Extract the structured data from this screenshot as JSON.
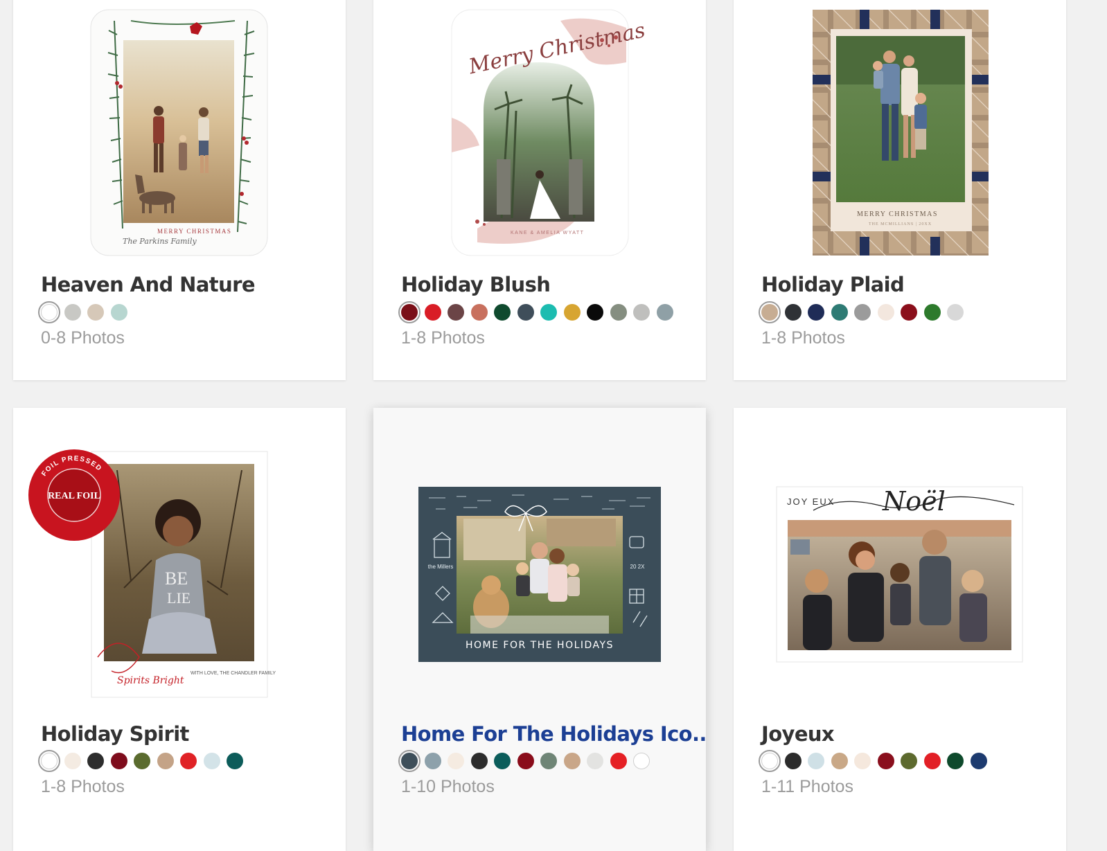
{
  "cards": [
    {
      "title": "Heaven And Nature",
      "photos": "0-8 Photos",
      "greeting": "MERRY CHRISTMAS",
      "signature": "The Parkins Family",
      "swatches": [
        "#ffffff",
        "#c8c8c4",
        "#d6c8b8",
        "#b7d6d0"
      ]
    },
    {
      "title": "Holiday Blush",
      "photos": "1-8 Photos",
      "greeting": "Merry Christmas",
      "signature": "KANE & AMELIA WYATT",
      "swatches": [
        "#7a0f18",
        "#d91d26",
        "#6b4446",
        "#c8705e",
        "#0f4a2e",
        "#3f4e5a",
        "#1cbcb0",
        "#d7a531",
        "#0a0a0a",
        "#858e80",
        "#bfbfbd",
        "#8fa0a6"
      ]
    },
    {
      "title": "Holiday Plaid",
      "photos": "1-8 Photos",
      "greeting": "MERRY CHRISTMAS",
      "signature": "THE MCMILLIANS | 20XX",
      "swatches": [
        "#c7ad93",
        "#2f3236",
        "#1f2c57",
        "#2e7b74",
        "#9b9b9b",
        "#f3e7de",
        "#8b0f1b",
        "#2d7a2c",
        "#d8d8d8"
      ]
    },
    {
      "title": "Holiday Spirit",
      "photos": "1-8 Photos",
      "badge_top": "FOIL PRESSED",
      "badge_main": "REAL FOIL",
      "greeting": "Spirits Bright",
      "signature": "WITH LOVE, THE CHANDLER FAMILY",
      "swatches": [
        "#ffffff",
        "#f4ebe2",
        "#2d2d2d",
        "#7e0c1c",
        "#5a6b2e",
        "#c4a387",
        "#e02226",
        "#d3e3e8",
        "#0c5c5a"
      ]
    },
    {
      "title": "Home For The Holidays Ico...",
      "photos": "1-10 Photos",
      "greeting": "HOME FOR THE HOLIDAYS",
      "left_text": "the Millers",
      "right_text": "20 2X",
      "swatches": [
        "#3e4f5a",
        "#8da1ab",
        "#f5ebe1",
        "#2c2c2c",
        "#0b5d5b",
        "#8a0c1a",
        "#6f8576",
        "#c9a688",
        "#e3e3e1",
        "#e52024",
        "#ffffff"
      ]
    },
    {
      "title": "Joyeux",
      "photos": "1-11 Photos",
      "greeting_small": "JOY EUX",
      "greeting": "Noël",
      "swatches": [
        "#ffffff",
        "#2c2c2c",
        "#cfe0e6",
        "#c9a887",
        "#f5e8dd",
        "#8a0f1d",
        "#5d6a2e",
        "#e21f26",
        "#0e4a2c",
        "#1d3b6f"
      ]
    }
  ],
  "colors": {
    "hover_title": "#1c3f94",
    "title": "#333333",
    "photos": "#9b9b9b",
    "foil_red": "#c8141f",
    "slate": "#3b4d59"
  }
}
